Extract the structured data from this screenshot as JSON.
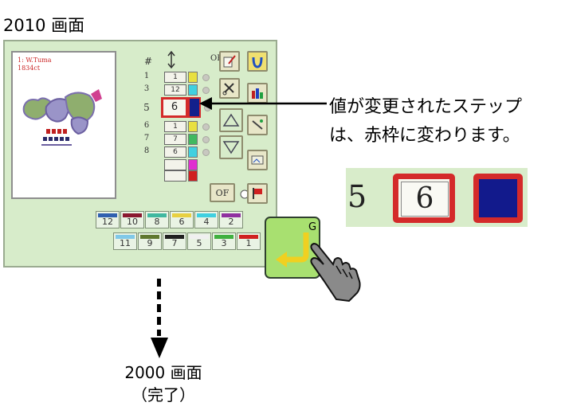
{
  "screen_title": "2010 画面",
  "preview": {
    "label_line1": "1: W.Tuma",
    "label_line2": "1834ct"
  },
  "table": {
    "col_number": "#",
    "col_dir_icon": "arrow-updown-icon",
    "col_op": "OP",
    "rows": [
      {
        "num": "1",
        "value": "1",
        "color": "#e8e040"
      },
      {
        "num": "3",
        "value": "12",
        "color": "#40d0e0"
      },
      {
        "num": "5",
        "value": "6",
        "color": "#12208c",
        "selected": true
      },
      {
        "num": "6",
        "value": "1",
        "color": "#e8e040"
      },
      {
        "num": "7",
        "value": "7",
        "color": "#40b860"
      },
      {
        "num": "8",
        "value": "6",
        "color": "#40d0e0"
      },
      {
        "num": "",
        "value": "",
        "color": "#e030d0"
      },
      {
        "num": "",
        "value": "",
        "color": "#d02020"
      }
    ]
  },
  "ofs_label": "OF",
  "thread_row1": [
    {
      "label": "12",
      "color": "#3060b0"
    },
    {
      "label": "10",
      "color": "#8a1830"
    },
    {
      "label": "8",
      "color": "#40b8a0"
    },
    {
      "label": "6",
      "color": "#e8d040"
    },
    {
      "label": "4",
      "color": "#40d0e0"
    },
    {
      "label": "2",
      "color": "#9030a0"
    }
  ],
  "thread_row2": [
    {
      "label": "11",
      "color": "#80c8e8"
    },
    {
      "label": "9",
      "color": "#607830"
    },
    {
      "label": "7",
      "color": "#202020"
    },
    {
      "label": "5",
      "color": "#f0f0f0"
    },
    {
      "label": "3",
      "color": "#40b040"
    },
    {
      "label": "1",
      "color": "#d02020"
    }
  ],
  "callout": {
    "line1": "値が変更されたステップ",
    "line2": "は、赤枠に変わります。"
  },
  "zoom": {
    "step": "5",
    "value": "6",
    "swatch_color": "#121a8c",
    "frame_color": "#d42a2a"
  },
  "enter_button": {
    "key_label": "G",
    "icon": "return-arrow-icon",
    "hand_icon": "pointing-hand-icon"
  },
  "finish": {
    "line1": "2000 画面",
    "line2": "（完了）"
  },
  "colors": {
    "screen_bg": "#d7ecca",
    "selection_red": "#d42a2a",
    "enter_yellow": "#f0d020"
  }
}
